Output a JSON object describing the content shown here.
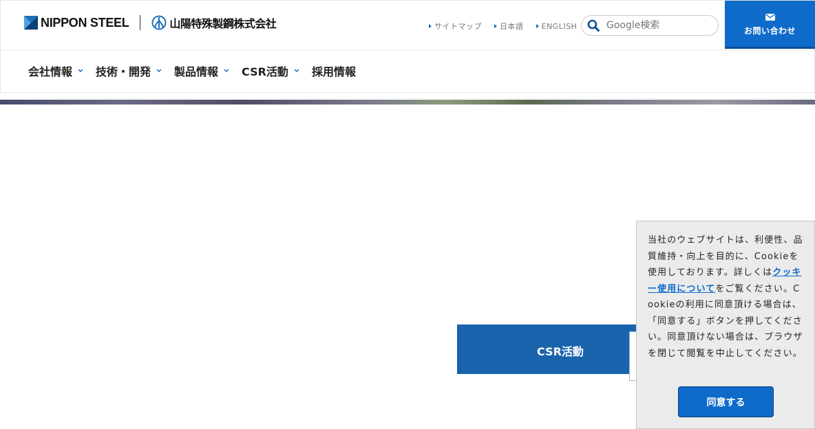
{
  "header": {
    "logo_primary": "NIPPON STEEL",
    "logo_secondary": "山陽特殊製鋼株式会社",
    "util_links": [
      {
        "label": "サイトマップ"
      },
      {
        "label": "日本語"
      },
      {
        "label": "ENGLISH"
      }
    ],
    "search": {
      "placeholder": "Google検索",
      "icon": "search-icon"
    },
    "contact": {
      "label": "お問い合わせ",
      "icon": "mail-icon"
    },
    "colors": {
      "accent": "#0e6bc9",
      "tile": "#1a63ad"
    }
  },
  "gnav": {
    "items": [
      {
        "label": "会社情報",
        "has_dropdown": true
      },
      {
        "label": "技術・開発",
        "has_dropdown": true
      },
      {
        "label": "製品情報",
        "has_dropdown": true
      },
      {
        "label": "CSR活動",
        "has_dropdown": true
      },
      {
        "label": "採用情報",
        "has_dropdown": false
      }
    ]
  },
  "main": {
    "csr_tile_label": "CSR活動"
  },
  "cookie_banner": {
    "text_before_link": "当社のウェブサイトは、利便性、品質維持・向上を目的に、Cookieを使用しております。詳しくは",
    "link_text": "クッキー使用について",
    "text_after_link": "をご覧ください。Cookieの利用に同意頂ける場合は、「同意する」ボタンを押してください。同意頂けない場合は、ブラウザを閉じて閲覧を中止してください。",
    "agree_label": "同意する"
  }
}
